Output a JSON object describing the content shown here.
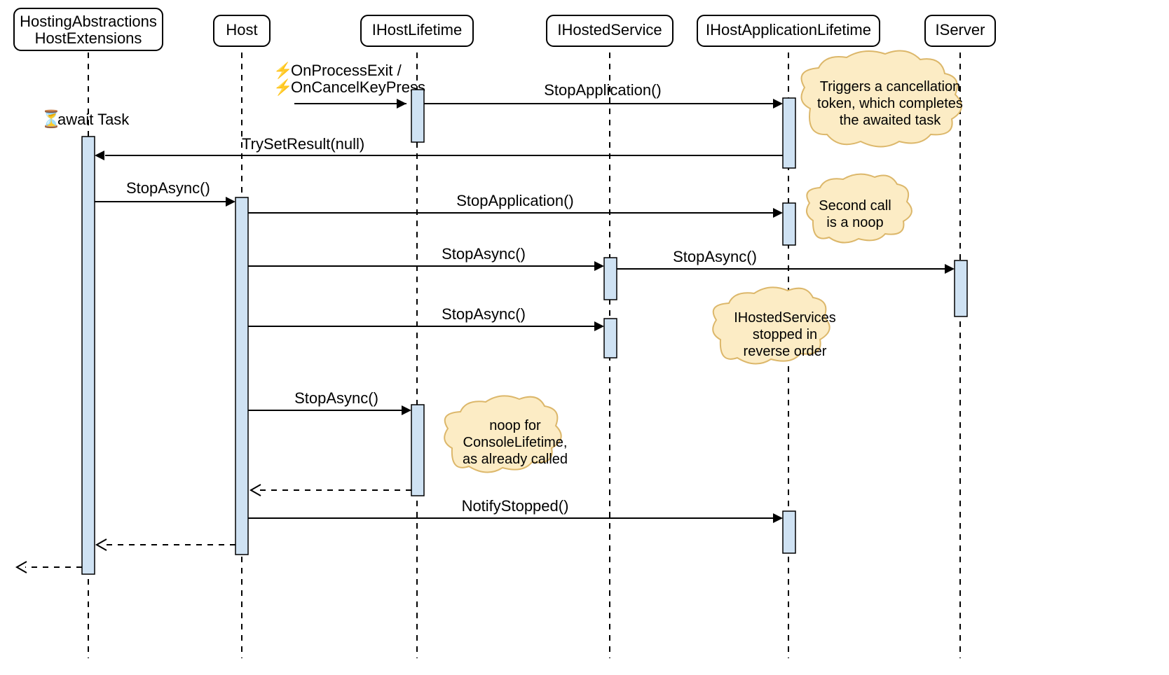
{
  "participants": {
    "p0": "HostingAbstractions HostExtensions",
    "p1": "Host",
    "p2": "IHostLifetime",
    "p3": "IHostedService",
    "p4": "IHostApplicationLifetime",
    "p5": "IServer"
  },
  "labels": {
    "awaitTask": "await Task",
    "onProcessExit": "OnProcessExit /",
    "onCancelKey": "OnCancelKeyPress",
    "stopApplication1": "StopApplication()",
    "trySetResult": "TrySetResult(null)",
    "stopAsync1": "StopAsync()",
    "stopApplication2": "StopApplication()",
    "stopAsync2": "StopAsync()",
    "stopAsync3": "StopAsync()",
    "stopAsync4": "StopAsync()",
    "stopAsync5": "StopAsync()",
    "notifyStopped": "NotifyStopped()"
  },
  "notes": {
    "n1l1": "Triggers a cancellation",
    "n1l2": "token, which completes",
    "n1l3": "the awaited task",
    "n2l1": "Second call",
    "n2l2": "is a noop",
    "n3l1": "IHostedServices",
    "n3l2": "stopped in",
    "n3l3": "reverse order",
    "n4l1": "noop for",
    "n4l2": "ConsoleLifetime,",
    "n4l3": "as already called"
  }
}
